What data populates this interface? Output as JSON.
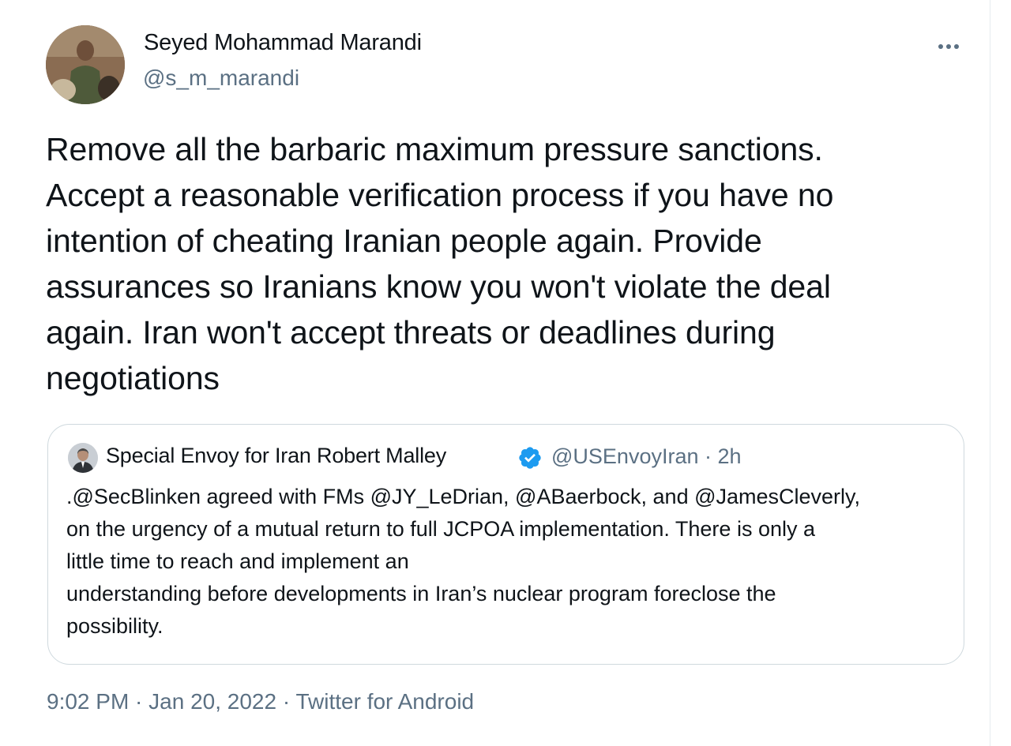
{
  "tweet": {
    "author": {
      "name": "Seyed Mohammad Marandi",
      "handle": "@s_m_marandi"
    },
    "text_lines": [
      "Remove all the barbaric maximum pressure sanctions.",
      "Accept a reasonable verification process if you have no",
      "intention of cheating Iranian people again. Provide",
      "assurances so Iranians know you won't violate the deal",
      "again. Iran won't accept threats or deadlines during",
      "negotiations"
    ],
    "quoted": {
      "name": "Special Envoy for Iran Robert Malley",
      "meta": "@USEnvoyIran · 2h",
      "text_lines": [
        ".@SecBlinken agreed with FMs @JY_LeDrian, @ABaerbock, and @JamesCleverly,",
        "on the urgency of a mutual return to full JCPOA implementation. There is only a",
        "little time to reach and implement an",
        "understanding before developments in Iran’s nuclear program foreclose the",
        "possibility."
      ]
    },
    "footer": {
      "time_date": "9:02 PM · Jan 20, 2022 · ",
      "client": "Twitter for Android"
    }
  },
  "icons": {
    "more": "more-horizontal-icon",
    "verified": "verified-badge-icon"
  },
  "colors": {
    "text": "#0f1419",
    "secondary": "#5b7083",
    "verified": "#1d9bf0",
    "border": "#cfd9de"
  }
}
